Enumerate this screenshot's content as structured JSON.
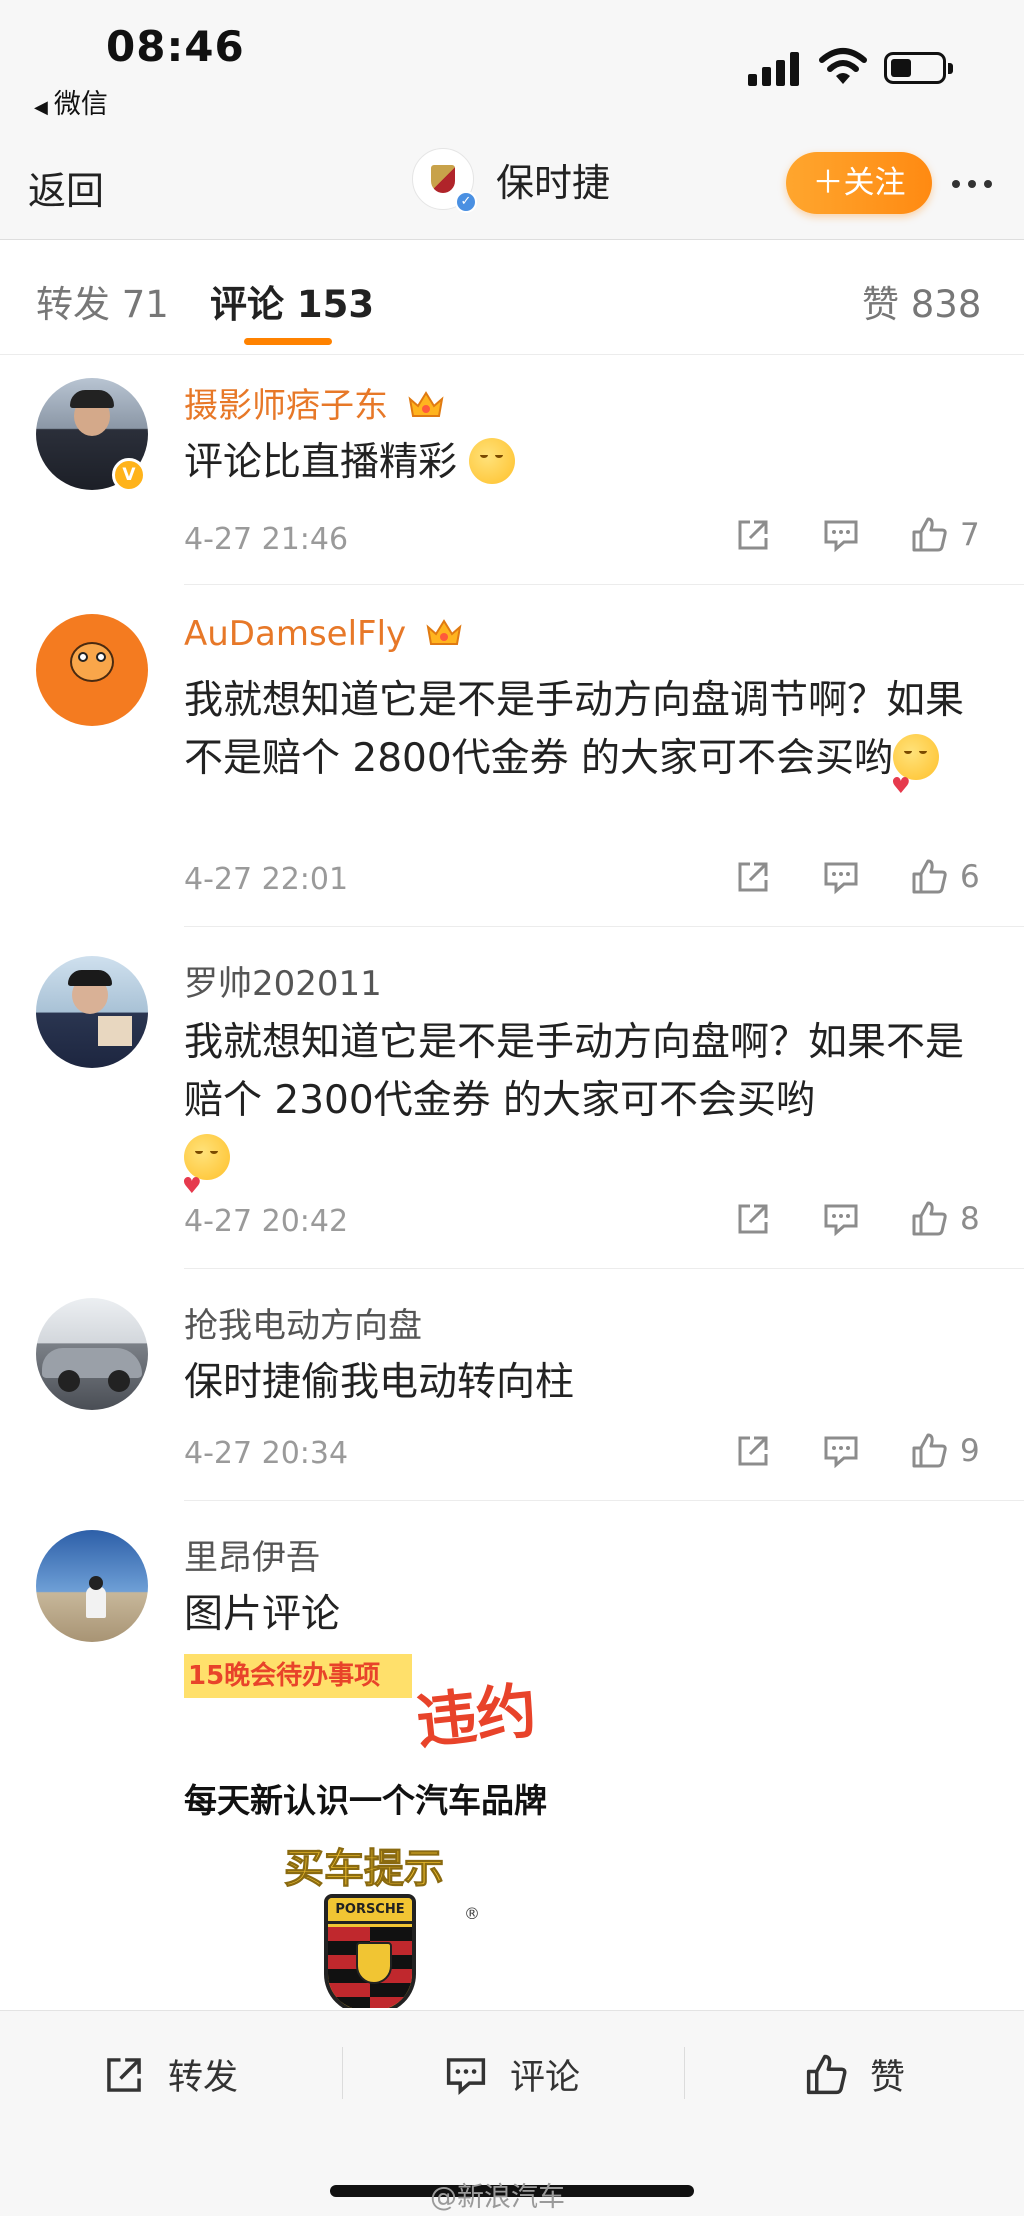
{
  "status_bar": {
    "time": "08:46",
    "back_app": "微信"
  },
  "nav": {
    "back_label": "返回",
    "account_name": "保时捷",
    "follow_label": "＋关注"
  },
  "tabs": {
    "repost": "转发 71",
    "comments": "评论 153",
    "likes": "赞 838"
  },
  "comments": [
    {
      "name": "摄影师痞子东",
      "text": "评论比直播精彩",
      "time": "4-27 21:46",
      "likes": "7"
    },
    {
      "name": "AuDamselFly",
      "text": "我就想知道它是不是手动方向盘调节啊？如果不是赔个 2800代金券 的大家可不会买哟",
      "time": "4-27 22:01",
      "likes": "6"
    },
    {
      "name": "罗帅202011",
      "text": "我就想知道它是不是手动方向盘啊？如果不是赔个 2300代金券 的大家可不会买哟",
      "time": "4-27 20:42",
      "likes": "8"
    },
    {
      "name": "抢我电动方向盘",
      "text": "保时捷偷我电动转向柱",
      "time": "4-27 20:34",
      "likes": "9"
    },
    {
      "name": "里昂伊吾",
      "text": "图片评论"
    }
  ],
  "image_comment": {
    "tag": "15晚会待办事项",
    "red_text": "违约",
    "line": "每天新认识一个汽车品牌",
    "yellow_text": "买车提示",
    "crest_text": "PORSCHE",
    "reg_mark": "®"
  },
  "bottom_bar": {
    "repost": "转发",
    "comment": "评论",
    "like": "赞",
    "watermark": "@新浪汽车"
  },
  "colors": {
    "accent": "#ff8200",
    "vip_name": "#e77828",
    "follow_button": "#ff9a1f"
  }
}
